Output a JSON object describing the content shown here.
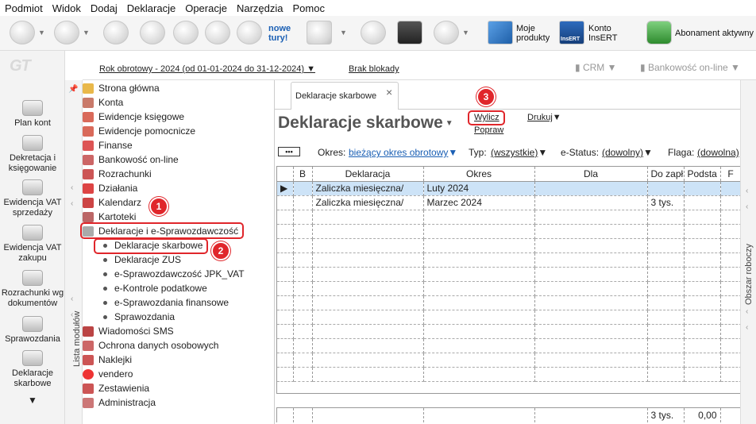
{
  "menu": [
    "Podmiot",
    "Widok",
    "Dodaj",
    "Deklaracje",
    "Operacje",
    "Narzędzia",
    "Pomoc"
  ],
  "toolbar": {
    "promo_line1": "nowe",
    "promo_line2": "tury!",
    "products_line1": "Moje",
    "products_line2": "produkty",
    "konto_line1": "Konto",
    "konto_line2": "InsERT",
    "insert_logo": "InsERT",
    "abonament": "Abonament aktywny"
  },
  "logo": "GT",
  "rail": [
    {
      "label1": "Plan kont",
      "label2": ""
    },
    {
      "label1": "Dekretacja i",
      "label2": "księgowanie"
    },
    {
      "label1": "Ewidencja VAT",
      "label2": "sprzedaży"
    },
    {
      "label1": "Ewidencja VAT",
      "label2": "zakupu"
    },
    {
      "label1": "Rozrachunki wg",
      "label2": "dokumentów"
    },
    {
      "label1": "Sprawozdania",
      "label2": ""
    },
    {
      "label1": "Deklaracje",
      "label2": "skarbowe"
    }
  ],
  "header": {
    "year": "Rok obrotowy - 2024  (od 01-01-2024 do 31-12-2024)",
    "lock": "Brak blokady",
    "crm": "CRM",
    "bank": "Bankowość on-line"
  },
  "modules_label": "Lista modułów",
  "workspace_label": "Obszar roboczy",
  "tree": {
    "top": [
      "Strona główna",
      "Konta",
      "Ewidencje księgowe",
      "Ewidencje pomocnicze",
      "Finanse",
      "Bankowość on-line",
      "Rozrachunki",
      "Działania",
      "Kalendarz",
      "Kartoteki"
    ],
    "group": "Deklaracje i e-Sprawozdawczość",
    "sub": [
      "Deklaracje skarbowe",
      "Deklaracje ZUS",
      "e-Sprawozdawczość JPK_VAT",
      "e-Kontrole podatkowe",
      "e-Sprawozdania finansowe",
      "Sprawozdania"
    ],
    "bottom": [
      "Wiadomości SMS",
      "Ochrona danych osobowych",
      "Naklejki",
      "vendero",
      "Zestawienia",
      "Administracja"
    ]
  },
  "badges": [
    "1",
    "2",
    "3"
  ],
  "tab": {
    "label": "Deklaracje skarbowe",
    "close": "×"
  },
  "page_title": "Deklaracje skarbowe",
  "actions": {
    "wylicz": "Wylicz",
    "popraw": "Popraw",
    "drukuj": "Drukuj"
  },
  "filters": {
    "more": "•••",
    "okres_label": "Okres:",
    "okres_value": "bieżący okres obrotowy",
    "typ_label": "Typ:",
    "typ_value": "(wszystkie)",
    "estatus_label": "e-Status:",
    "estatus_value": "(dowolny)",
    "flaga_label": "Flaga:",
    "flaga_value": "(dowolna)"
  },
  "grid": {
    "columns": [
      "",
      "B",
      "Deklaracja",
      "Okres",
      "Dla",
      "Do zapł",
      "Podsta",
      "F"
    ],
    "rows": [
      {
        "marker": "▶",
        "b": "",
        "deklaracja": "Zaliczka miesięczna/",
        "okres": "Luty 2024",
        "dla": "",
        "dozapl": "",
        "podst": "",
        "f": ""
      },
      {
        "marker": "",
        "b": "",
        "deklaracja": "Zaliczka miesięczna/",
        "okres": "Marzec 2024",
        "dla": "",
        "dozapl": "3 tys.",
        "podst": "",
        "f": ""
      }
    ]
  },
  "footer": {
    "dozapl": "3 tys.",
    "podst": "0,00"
  }
}
